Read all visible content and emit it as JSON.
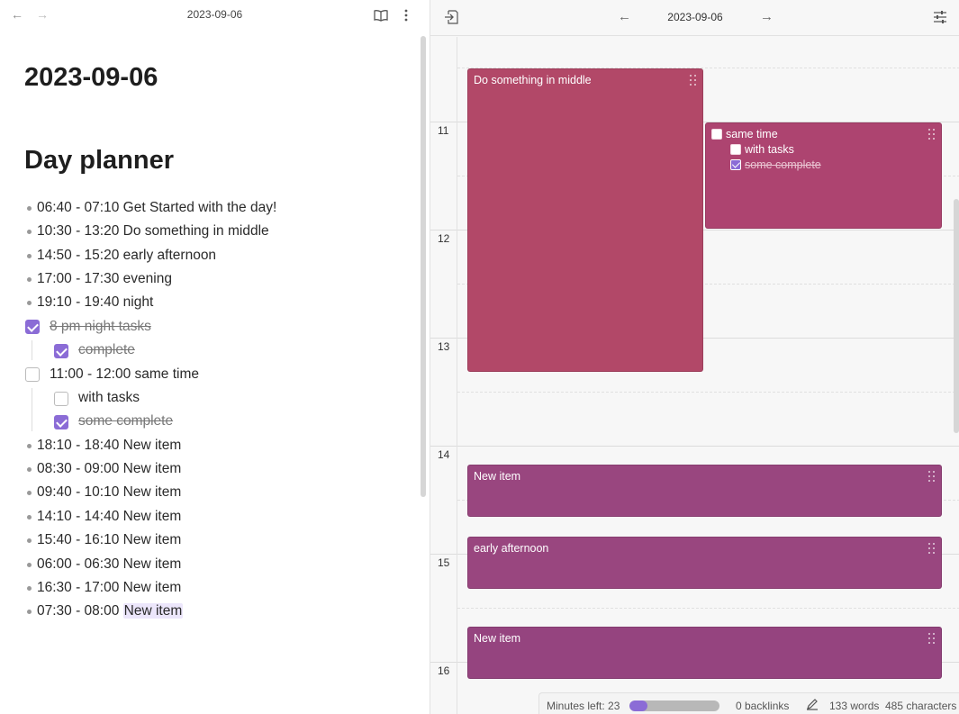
{
  "left_header": {
    "date": "2023-09-06",
    "back": "←",
    "forward": "→",
    "icons": [
      "reading-mode-icon",
      "more-options-icon"
    ]
  },
  "note": {
    "title": "2023-09-06",
    "heading": "Day planner",
    "items": [
      {
        "type": "bullet",
        "text": "06:40 - 07:10 Get Started with the day!"
      },
      {
        "type": "bullet",
        "text": "10:30 - 13:20 Do something in middle"
      },
      {
        "type": "bullet",
        "text": "14:50 - 15:20 early afternoon"
      },
      {
        "type": "bullet",
        "text": "17:00 - 17:30 evening"
      },
      {
        "type": "bullet",
        "text": "19:10 - 19:40 night"
      },
      {
        "type": "task",
        "checked": true,
        "text": "8 pm night tasks"
      },
      {
        "type": "subtask",
        "checked": true,
        "text": "complete"
      },
      {
        "type": "task",
        "checked": false,
        "text": "11:00 - 12:00 same time"
      },
      {
        "type": "subtask",
        "checked": false,
        "text": "with tasks"
      },
      {
        "type": "subtask",
        "checked": true,
        "text": "some complete"
      },
      {
        "type": "bullet",
        "text": "18:10 - 18:40 New item"
      },
      {
        "type": "bullet",
        "text": "08:30 - 09:00 New item"
      },
      {
        "type": "bullet",
        "text": "09:40 - 10:10 New item"
      },
      {
        "type": "bullet",
        "text": "14:10 - 14:40 New item"
      },
      {
        "type": "bullet",
        "text": "15:40 - 16:10 New item"
      },
      {
        "type": "bullet",
        "text": "06:00 - 06:30 New item"
      },
      {
        "type": "bullet",
        "text": "16:30 - 17:00 New item"
      },
      {
        "type": "bullet",
        "text": "07:30 - 08:00",
        "highlight": "New item"
      }
    ]
  },
  "timeline": {
    "date": "2023-09-06",
    "back": "←",
    "forward": "→",
    "hours": [
      "11",
      "12",
      "13",
      "14",
      "15",
      "16"
    ],
    "events": [
      {
        "title": "Do something in middle",
        "color": "#b24868",
        "start": "10:30",
        "end": "13:20"
      },
      {
        "title": "same time",
        "color": "#ad4470",
        "start": "11:00",
        "end": "12:00",
        "tasks": [
          {
            "text": "with tasks",
            "checked": false
          },
          {
            "text": "some complete",
            "checked": true
          }
        ]
      },
      {
        "title": "New item",
        "color": "#99467f",
        "start": "14:10",
        "end": "14:40"
      },
      {
        "title": "early afternoon",
        "color": "#99467f",
        "start": "14:50",
        "end": "15:20"
      },
      {
        "title": "New item",
        "color": "#95447f",
        "start": "15:40",
        "end": "16:10"
      }
    ]
  },
  "status": {
    "minutes_left": "Minutes left: 23",
    "progress": 0.2,
    "backlinks": "0 backlinks",
    "words": "133 words",
    "characters": "485 characters"
  },
  "colors": {
    "accent": "#8b6cd6"
  }
}
